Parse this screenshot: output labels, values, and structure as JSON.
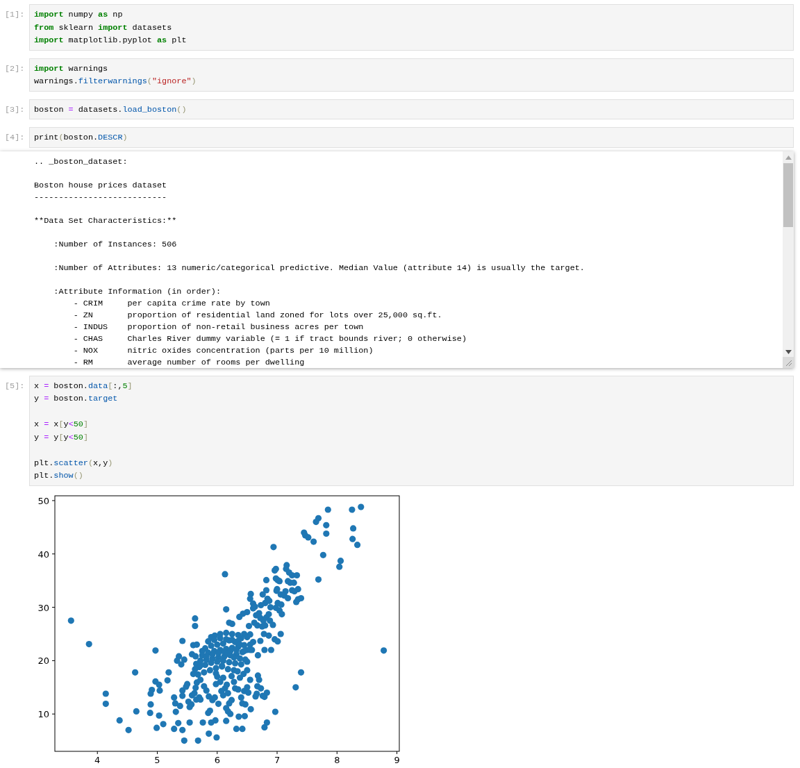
{
  "cells": [
    {
      "prompt": "[1]:",
      "code": [
        {
          "kind": "code",
          "tokens": [
            {
              "kind": "kw",
              "text": "import"
            },
            {
              "kind": "plain",
              "text": " numpy "
            },
            {
              "kind": "kw",
              "text": "as"
            },
            {
              "kind": "plain",
              "text": " np"
            }
          ]
        },
        {
          "kind": "code",
          "tokens": [
            {
              "kind": "kw",
              "text": "from"
            },
            {
              "kind": "plain",
              "text": " sklearn "
            },
            {
              "kind": "kw",
              "text": "import"
            },
            {
              "kind": "plain",
              "text": " datasets"
            }
          ]
        },
        {
          "kind": "code",
          "tokens": [
            {
              "kind": "kw",
              "text": "import"
            },
            {
              "kind": "plain",
              "text": " matplotlib.pyplot "
            },
            {
              "kind": "kw",
              "text": "as"
            },
            {
              "kind": "plain",
              "text": " plt"
            }
          ]
        }
      ]
    },
    {
      "prompt": "[2]:",
      "code": [
        {
          "kind": "code",
          "tokens": [
            {
              "kind": "kw",
              "text": "import"
            },
            {
              "kind": "plain",
              "text": " warnings"
            }
          ]
        },
        {
          "kind": "code",
          "tokens": [
            {
              "kind": "plain",
              "text": "warnings."
            },
            {
              "kind": "prop",
              "text": "filterwarnings"
            },
            {
              "kind": "br",
              "text": "("
            },
            {
              "kind": "str",
              "text": "\"ignore\""
            },
            {
              "kind": "br",
              "text": ")"
            }
          ]
        }
      ]
    },
    {
      "prompt": "[3]:",
      "code": [
        {
          "kind": "code",
          "tokens": [
            {
              "kind": "plain",
              "text": "boston "
            },
            {
              "kind": "op",
              "text": "="
            },
            {
              "kind": "plain",
              "text": " datasets."
            },
            {
              "kind": "prop",
              "text": "load_boston"
            },
            {
              "kind": "br",
              "text": "()"
            }
          ]
        }
      ]
    },
    {
      "prompt": "[4]:",
      "code": [
        {
          "kind": "code",
          "tokens": [
            {
              "kind": "plain",
              "text": "print"
            },
            {
              "kind": "br",
              "text": "("
            },
            {
              "kind": "plain",
              "text": "boston."
            },
            {
              "kind": "prop",
              "text": "DESCR"
            },
            {
              "kind": "br",
              "text": ")"
            }
          ]
        }
      ],
      "output": {
        "kind": "text",
        "lines": [
          {
            "kind": "text",
            "text": ".. _boston_dataset:"
          },
          {
            "kind": "blank"
          },
          {
            "kind": "text",
            "text": "Boston house prices dataset"
          },
          {
            "kind": "text",
            "text": "---------------------------"
          },
          {
            "kind": "blank"
          },
          {
            "kind": "text",
            "text": "**Data Set Characteristics:**"
          },
          {
            "kind": "blank"
          },
          {
            "kind": "text",
            "text": "    :Number of Instances: 506"
          },
          {
            "kind": "blank"
          },
          {
            "kind": "text",
            "text": "    :Number of Attributes: 13 numeric/categorical predictive. Median Value (attribute 14) is usually the target."
          },
          {
            "kind": "blank"
          },
          {
            "kind": "text",
            "text": "    :Attribute Information (in order):"
          },
          {
            "kind": "text",
            "text": "        - CRIM     per capita crime rate by town"
          },
          {
            "kind": "text",
            "text": "        - ZN       proportion of residential land zoned for lots over 25,000 sq.ft."
          },
          {
            "kind": "text",
            "text": "        - INDUS    proportion of non-retail business acres per town"
          },
          {
            "kind": "text",
            "text": "        - CHAS     Charles River dummy variable (= 1 if tract bounds river; 0 otherwise)"
          },
          {
            "kind": "text",
            "text": "        - NOX      nitric oxides concentration (parts per 10 million)"
          },
          {
            "kind": "text",
            "text": "        - RM       average number of rooms per dwelling"
          }
        ]
      }
    },
    {
      "prompt": "[5]:",
      "code": [
        {
          "kind": "code",
          "tokens": [
            {
              "kind": "plain",
              "text": "x "
            },
            {
              "kind": "op",
              "text": "="
            },
            {
              "kind": "plain",
              "text": " boston."
            },
            {
              "kind": "prop",
              "text": "data"
            },
            {
              "kind": "br",
              "text": "["
            },
            {
              "kind": "plain",
              "text": ":,"
            },
            {
              "kind": "num",
              "text": "5"
            },
            {
              "kind": "br",
              "text": "]"
            }
          ]
        },
        {
          "kind": "code",
          "tokens": [
            {
              "kind": "plain",
              "text": "y "
            },
            {
              "kind": "op",
              "text": "="
            },
            {
              "kind": "plain",
              "text": " boston."
            },
            {
              "kind": "prop",
              "text": "target"
            }
          ]
        },
        {
          "kind": "blank"
        },
        {
          "kind": "code",
          "tokens": [
            {
              "kind": "plain",
              "text": "x "
            },
            {
              "kind": "op",
              "text": "="
            },
            {
              "kind": "plain",
              "text": " x"
            },
            {
              "kind": "br",
              "text": "["
            },
            {
              "kind": "plain",
              "text": "y"
            },
            {
              "kind": "op",
              "text": "<"
            },
            {
              "kind": "num",
              "text": "50"
            },
            {
              "kind": "br",
              "text": "]"
            }
          ]
        },
        {
          "kind": "code",
          "tokens": [
            {
              "kind": "plain",
              "text": "y "
            },
            {
              "kind": "op",
              "text": "="
            },
            {
              "kind": "plain",
              "text": " y"
            },
            {
              "kind": "br",
              "text": "["
            },
            {
              "kind": "plain",
              "text": "y"
            },
            {
              "kind": "op",
              "text": "<"
            },
            {
              "kind": "num",
              "text": "50"
            },
            {
              "kind": "br",
              "text": "]"
            }
          ]
        },
        {
          "kind": "blank"
        },
        {
          "kind": "code",
          "tokens": [
            {
              "kind": "plain",
              "text": "plt."
            },
            {
              "kind": "prop",
              "text": "scatter"
            },
            {
              "kind": "br",
              "text": "("
            },
            {
              "kind": "plain",
              "text": "x,y"
            },
            {
              "kind": "br",
              "text": ")"
            }
          ]
        },
        {
          "kind": "code",
          "tokens": [
            {
              "kind": "plain",
              "text": "plt."
            },
            {
              "kind": "prop",
              "text": "show"
            },
            {
              "kind": "br",
              "text": "()"
            }
          ]
        }
      ],
      "output": {
        "kind": "plot",
        "chart_data": {
          "type": "scatter",
          "xlim": [
            3.29,
            9.04
          ],
          "ylim": [
            3.0,
            50.9
          ],
          "xticks": [
            4,
            5,
            6,
            7,
            8,
            9
          ],
          "yticks": [
            10,
            20,
            30,
            40,
            50
          ],
          "x": [
            3.56,
            3.86,
            4.14,
            4.14,
            4.37,
            4.52,
            4.63,
            4.65,
            8.78,
            7.31,
            7.4,
            6.97,
            6.13,
            6.15,
            4.97,
            8.4,
            8.25,
            7.85,
            7.69,
            7.65,
            7.82,
            8.27,
            7.45,
            7.47,
            7.52,
            7.61,
            8.26,
            8.34,
            7.82,
            6.94,
            7.77,
            8.06,
            8.04,
            7.69,
            7.16,
            7.15,
            6.98,
            6.96,
            7.2,
            7.25,
            7.33,
            6.98,
            7.01,
            7.04,
            6.82,
            7.18,
            7.22,
            7.28,
            7.35,
            7.25,
            7.29,
            7.14,
            6.99,
            7.0,
            7.06,
            7.12,
            7.18,
            7.4,
            7.35,
            7.32,
            6.82,
            6.76,
            6.56,
            6.55,
            6.6,
            6.63,
            6.73,
            6.8,
            6.84,
            6.87,
            6.89,
            6.98,
            7.01,
            7.07,
            7.04,
            7.08,
            6.5,
            6.43,
            6.37,
            6.6,
            6.65,
            6.7,
            6.72,
            6.77,
            6.82,
            6.86,
            6.88,
            6.93,
            6.62,
            6.53,
            6.67,
            6.75,
            6.8,
            6.86,
            6.96,
            7.01,
            7.06,
            6.78,
            6.9,
            6.79,
            6.68,
            6.58,
            6.72,
            6.6,
            6.55,
            6.45,
            6.2,
            6.25,
            5.63,
            5.63,
            5.9,
            5.96,
            6.05,
            6.15,
            6.25,
            6.35,
            6.4,
            6.5,
            6.3,
            6.2,
            6.1,
            6.0,
            5.9,
            5.8,
            5.75,
            5.85,
            5.95,
            6.05,
            6.15,
            6.25,
            6.35,
            6.45,
            6.55,
            6.42,
            6.32,
            6.22,
            6.12,
            6.02,
            5.92,
            5.82,
            5.72,
            5.65,
            5.7,
            5.8,
            5.9,
            6.0,
            6.1,
            6.2,
            6.3,
            6.4,
            6.5,
            6.47,
            5.98,
            6.08,
            6.18,
            6.28,
            5.88,
            5.78,
            5.68,
            5.6,
            5.63,
            5.6,
            5.66,
            5.42,
            5.58,
            5.64,
            5.36,
            5.33,
            5.4,
            5.45,
            6.55,
            6.5,
            6.38,
            5.85,
            5.95,
            6.05,
            6.15,
            6.25,
            6.35,
            5.75,
            6.45,
            5.92,
            6.02,
            6.12,
            6.22,
            6.32,
            5.82,
            5.72,
            6.08,
            6.18,
            6.28,
            6.38,
            5.98,
            5.19,
            5.17,
            4.97,
            5.03,
            4.91,
            4.89,
            5.04,
            4.89,
            4.88,
            5.03,
            4.99,
            5.1,
            5.28,
            5.35,
            5.42,
            5.45,
            5.54,
            5.68,
            5.76,
            5.86,
            5.99,
            5.9,
            5.97,
            5.85,
            5.88,
            5.31,
            5.3,
            5.28,
            5.38,
            5.42,
            5.42,
            5.48,
            5.5,
            5.52,
            5.54,
            5.57,
            5.58,
            5.62,
            5.65,
            5.7,
            5.72,
            5.64,
            5.66,
            5.72,
            5.78,
            5.82,
            5.86,
            5.92,
            5.96,
            5.98,
            6.05,
            6.02,
            6.07,
            6.1,
            6.13,
            6.16,
            6.18,
            6.15,
            6.18,
            6.22,
            6.2,
            6.24,
            6.15,
            6.32,
            6.42,
            6.36,
            6.46,
            6.3,
            6.28,
            6.35,
            6.4,
            6.42,
            6.47,
            6.45,
            6.5,
            6.52,
            6.38,
            6.44,
            6.5,
            6.55,
            6.56,
            6.64,
            6.66,
            6.67,
            6.68,
            6.7,
            6.73,
            6.76,
            6.79,
            6.83,
            6.79,
            6.83,
            6.0,
            6.1,
            6.24,
            6.34
          ],
          "series": [
            {
              "color": "#1f77b4",
              "values": [
                27.5,
                23.1,
                13.8,
                11.9,
                8.8,
                7.0,
                17.8,
                10.5,
                21.9,
                15.0,
                17.8,
                10.4,
                36.2,
                29.6,
                21.9,
                48.8,
                48.3,
                48.3,
                46.7,
                46.0,
                45.4,
                44.8,
                44.0,
                43.5,
                43.1,
                42.3,
                42.8,
                41.7,
                43.8,
                41.3,
                39.8,
                38.7,
                37.6,
                35.2,
                37.9,
                37.2,
                37.2,
                36.9,
                36.5,
                36.0,
                36.0,
                35.4,
                35.1,
                34.9,
                35.1,
                34.9,
                34.6,
                34.6,
                33.4,
                33.2,
                33.0,
                33.0,
                33.1,
                33.4,
                32.4,
                32.2,
                31.7,
                31.7,
                31.5,
                31.0,
                33.2,
                32.4,
                32.5,
                31.6,
                30.7,
                30.1,
                30.4,
                30.8,
                31.6,
                31.2,
                30.0,
                29.9,
                30.8,
                30.5,
                29.4,
                28.7,
                29.1,
                28.8,
                28.2,
                29.8,
                28.5,
                28.9,
                28.0,
                27.5,
                28.1,
                28.7,
                27.5,
                26.7,
                27.1,
                26.5,
                26.6,
                26.4,
                26.6,
                24.7,
                24.0,
                23.6,
                25.0,
                25.0,
                22.0,
                22.0,
                21.0,
                22.0,
                23.7,
                23.5,
                24.9,
                25.0,
                27.1,
                26.9,
                27.9,
                26.5,
                24.4,
                24.7,
                25.0,
                25.2,
                25.0,
                24.8,
                24.2,
                24.4,
                23.5,
                23.8,
                23.2,
                23.0,
                22.8,
                22.3,
                21.8,
                21.5,
                21.8,
                22.0,
                22.2,
                22.4,
                22.6,
                22.9,
                23.0,
                21.6,
                21.2,
                21.0,
                20.8,
                20.6,
                20.4,
                20.2,
                20.0,
                19.4,
                18.8,
                19.2,
                19.6,
                19.8,
                20.0,
                19.7,
                19.5,
                19.3,
                19.8,
                20.2,
                18.6,
                18.9,
                18.4,
                18.2,
                18.2,
                17.8,
                17.4,
                17.5,
                18.4,
                22.9,
                23.0,
                23.7,
                21.2,
                20.8,
                20.8,
                20.0,
                19.3,
                20.2,
                22.0,
                22.0,
                20.4,
                23.6,
                23.9,
                24.2,
                24.0,
                23.9,
                23.7,
                21.0,
                21.8,
                21.2,
                21.4,
                21.6,
                21.8,
                22.0,
                20.8,
                19.1,
                19.0,
                21.3,
                20.6,
                23.0,
                17.6,
                17.8,
                16.3,
                16.1,
                15.5,
                14.5,
                13.8,
                14.4,
                11.8,
                10.2,
                9.7,
                7.4,
                8.1,
                7.2,
                8.3,
                7.0,
                5.0,
                8.4,
                5.0,
                8.4,
                6.3,
                5.6,
                8.4,
                8.8,
                10.2,
                10.6,
                10.4,
                12.0,
                13.1,
                11.5,
                13.4,
                14.4,
                15.1,
                15.6,
                12.3,
                11.3,
                11.8,
                13.5,
                13.9,
                12.7,
                13.1,
                12.7,
                14.9,
                15.9,
                16.4,
                15.2,
                14.4,
                13.3,
                12.6,
                13.1,
                15.6,
                16.0,
                11.9,
                14.3,
                13.5,
                14.8,
                15.5,
                13.9,
                11.1,
                10.5,
                10.0,
                12.0,
                12.6,
                8.7,
                7.2,
                7.2,
                9.5,
                9.6,
                14.8,
                16.0,
                14.6,
                13.1,
                12.0,
                11.8,
                14.3,
                15.0,
                14.0,
                16.8,
                17.5,
                18.2,
                16.4,
                10.9,
                13.3,
                13.8,
                15.2,
                17.2,
                16.4,
                14.8,
                13.4,
                13.2,
                14.0,
                7.5,
                8.4,
                17.0,
                16.8,
                17.1,
                18.0
              ]
            }
          ]
        }
      }
    }
  ]
}
